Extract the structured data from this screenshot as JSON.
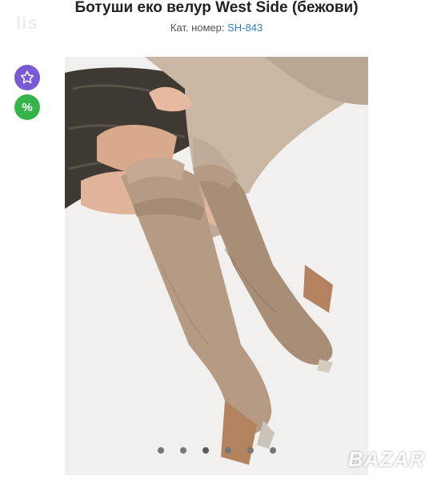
{
  "site": {
    "logo_text": "lis",
    "watermark": "BAZAR"
  },
  "product": {
    "title": "Ботуши еко велур West Side (бежови)",
    "sku_label": "Кат. номер: ",
    "sku_code": "SH-843"
  },
  "actions": {
    "favorite_icon": "star-outline-icon",
    "promo_icon": "percent-icon",
    "promo_symbol": "%",
    "favorite_color": "#7a5bd6",
    "promo_color": "#35b44a"
  },
  "gallery": {
    "image_count": 6,
    "active_index": 2,
    "image_subject": "beige suede knee-high western boots"
  }
}
